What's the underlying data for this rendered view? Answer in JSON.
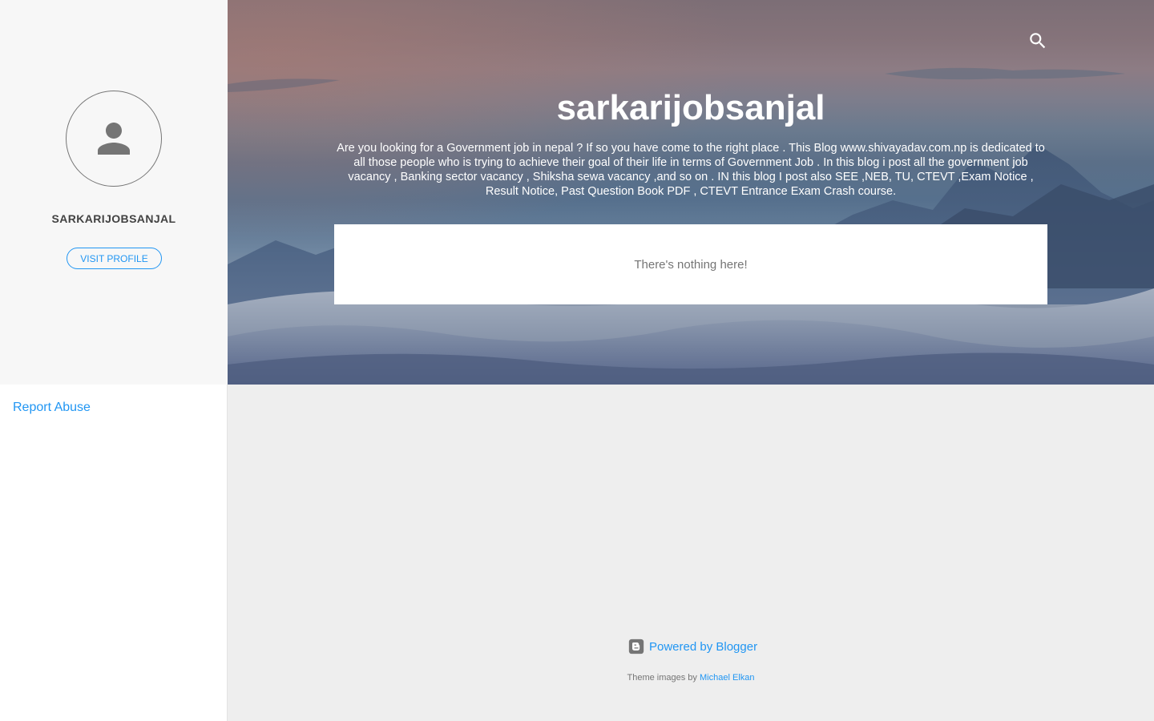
{
  "sidebar": {
    "profile_name": "SARKARIJOBSANJAL",
    "visit_profile_label": "VISIT PROFILE",
    "report_abuse_label": "Report Abuse"
  },
  "header": {
    "blog_title": "sarkarijobsanjal",
    "description": "Are you looking for a Government job in nepal ? If so you have come to the right place . This Blog www.shivayadav.com.np is dedicated to all those people who is trying to achieve their goal of their life in terms of Government Job . In this blog i post all the government job vacancy , Banking sector vacancy , Shiksha sewa vacancy ,and so on . IN this blog I post also SEE ,NEB, TU, CTEVT ,Exam Notice , Result Notice, Past Question Book PDF , CTEVT Entrance Exam Crash course.",
    "search_icon": "search-icon"
  },
  "main": {
    "empty_message": "There's nothing here!"
  },
  "footer": {
    "powered_by_label": "Powered by Blogger",
    "theme_credit_prefix": "Theme images by",
    "theme_credit_author": "Michael Elkan"
  },
  "colors": {
    "accent": "#2196f3",
    "sidebar_panel": "#f7f7f7",
    "page_background": "#eeeeee",
    "text_muted": "#757575"
  }
}
